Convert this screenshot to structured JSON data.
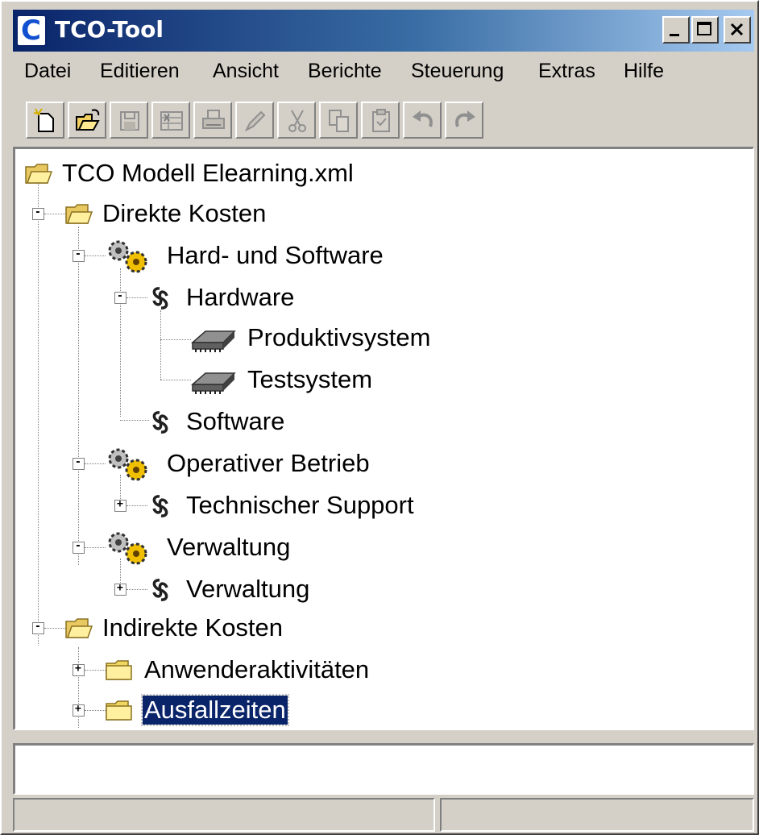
{
  "window": {
    "title": "TCO-Tool",
    "app_icon_letter": "C"
  },
  "menubar": {
    "items": [
      "Datei",
      "Editieren",
      "Ansicht",
      "Berichte",
      "Steuerung",
      "Extras",
      "Hilfe"
    ]
  },
  "toolbar": {
    "buttons": [
      {
        "name": "new-icon",
        "enabled": true
      },
      {
        "name": "open-icon",
        "enabled": true
      },
      {
        "name": "save-icon",
        "enabled": false
      },
      {
        "name": "excel-export-icon",
        "enabled": false
      },
      {
        "name": "print-icon",
        "enabled": false
      },
      {
        "name": "edit-icon",
        "enabled": false
      },
      {
        "name": "cut-icon",
        "enabled": false
      },
      {
        "name": "copy-icon",
        "enabled": false
      },
      {
        "name": "paste-icon",
        "enabled": false
      },
      {
        "name": "undo-icon",
        "enabled": false
      },
      {
        "name": "redo-icon",
        "enabled": false
      }
    ]
  },
  "tree": {
    "root": "TCO Modell Elearning.xml",
    "nodes": [
      "Direkte Kosten",
      "Hard- und Software",
      "Hardware",
      "Produktivsystem",
      "Testsystem",
      "Software",
      "Operativer Betrieb",
      "Technischer Support",
      "Verwaltung",
      "Verwaltung",
      "Indirekte Kosten",
      "Anwenderaktivitäten",
      "Ausfallzeiten"
    ],
    "selected": "Ausfallzeiten"
  },
  "details": {
    "text": ""
  },
  "statusbar": {
    "left": "",
    "right": ""
  }
}
